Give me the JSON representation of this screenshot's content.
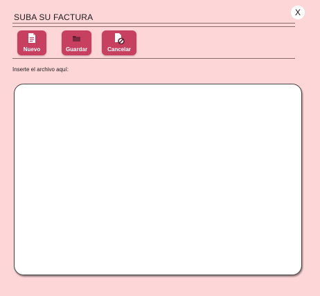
{
  "dialog": {
    "title": "SUBA SU FACTURA",
    "close_label": "X"
  },
  "toolbar": {
    "buttons": [
      {
        "label": "Nuevo",
        "icon": "new-document-icon"
      },
      {
        "label": "Guardar",
        "icon": "folder-icon"
      },
      {
        "label": "Cancelar",
        "icon": "cancel-document-icon"
      }
    ]
  },
  "upload": {
    "instruction": "Inserte el archivo aquí:"
  },
  "colors": {
    "background": "#fdd6d8",
    "button": "#c8405f",
    "drop_area": "#ffffff"
  }
}
